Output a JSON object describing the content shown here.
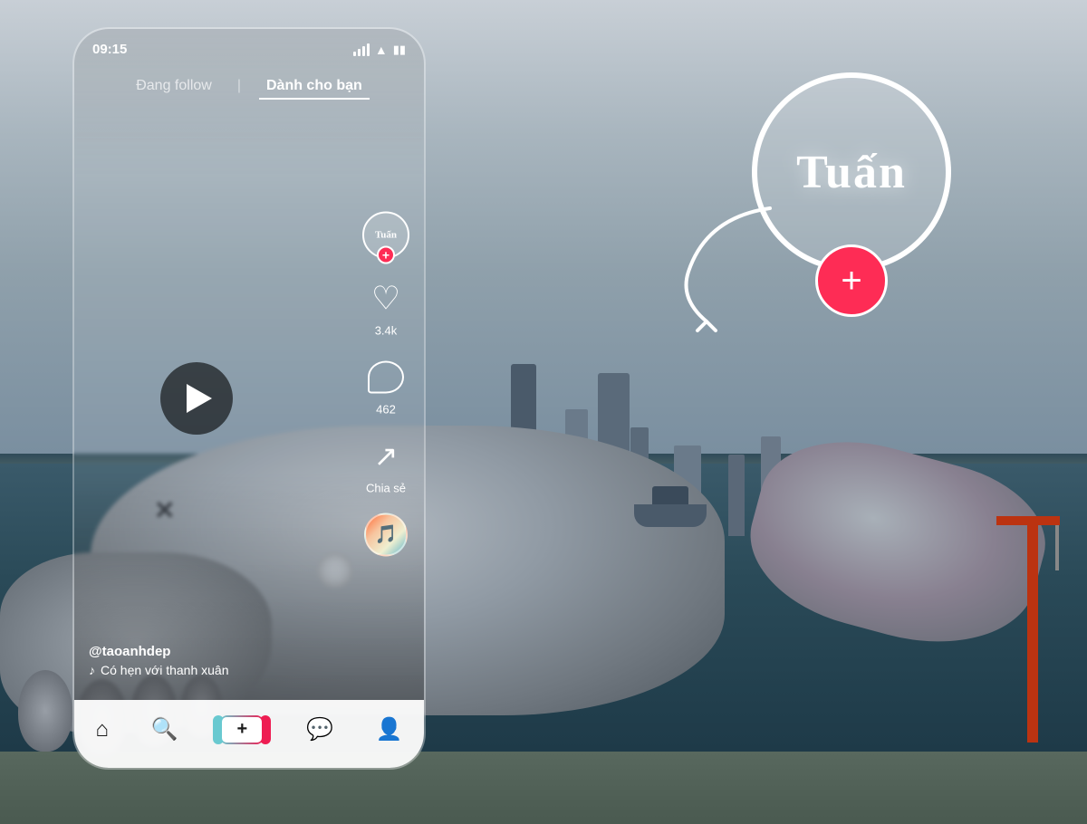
{
  "time": "09:15",
  "nav": {
    "following_label": "Đang follow",
    "for_you_label": "Dành cho bạn"
  },
  "actions": {
    "likes": "3.4k",
    "comments": "462",
    "share_label": "Chia sẻ"
  },
  "caption": {
    "username": "@taoanhdep",
    "music": "Có hẹn với thanh xuân"
  },
  "tuan": {
    "name": "Tuấn"
  },
  "bottom_nav": {
    "home": "🏠",
    "search": "🔍",
    "inbox": "💬",
    "profile": "👤"
  },
  "colors": {
    "accent": "#fe2c55",
    "tiktok_blue": "#69c9d0"
  }
}
